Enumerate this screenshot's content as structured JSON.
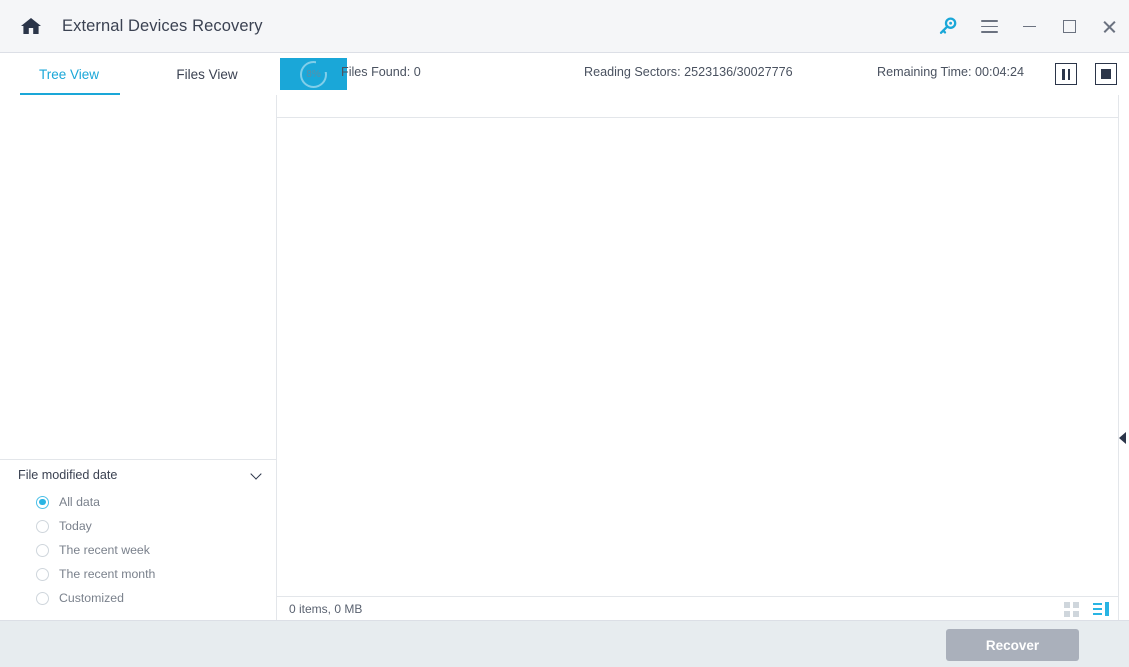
{
  "titlebar": {
    "home_icon": "home-icon",
    "title": "External Devices Recovery",
    "key_icon": "key-icon",
    "menu_icon": "hamburger-menu-icon",
    "minimize_icon": "minimize-icon",
    "maximize_icon": "maximize-icon",
    "close_icon": "close-icon"
  },
  "tabs": [
    {
      "label": "Tree View",
      "active": true
    },
    {
      "label": "Files View",
      "active": false
    }
  ],
  "scan_status": {
    "progress_percent": "8%",
    "files_found_label": "Files Found:",
    "files_found_value": "0",
    "reading_sectors_label": "Reading Sectors:",
    "reading_sectors_value": "2523136/30027776",
    "remaining_time_label": "Remaining Time:",
    "remaining_time_value": "00:04:24",
    "pause_icon": "pause-icon",
    "stop_icon": "stop-icon"
  },
  "filter": {
    "title": "File modified date",
    "collapse_icon": "chevron-down-icon",
    "options": [
      {
        "label": "All data",
        "selected": true
      },
      {
        "label": "Today",
        "selected": false
      },
      {
        "label": "The recent week",
        "selected": false
      },
      {
        "label": "The recent month",
        "selected": false
      },
      {
        "label": "Customized",
        "selected": false
      }
    ]
  },
  "main_panel": {
    "footer_count": "0 items, 0 MB",
    "grid_view_icon": "grid-view-icon",
    "list_view_icon": "list-view-icon",
    "collapse_panel_icon": "collapse-left-arrow-icon"
  },
  "bottombar": {
    "recover_label": "Recover",
    "recover_disabled": true
  },
  "colors": {
    "accent": "#1aa7d8",
    "accent_light": "#29b4e3",
    "title_text": "#3b4252",
    "muted_text": "#7a818c",
    "titlebar_bg": "#f5f6f8",
    "bottombar_bg": "#e7ecef",
    "disabled_button": "#aab0bb",
    "border": "#e3e6ea"
  }
}
